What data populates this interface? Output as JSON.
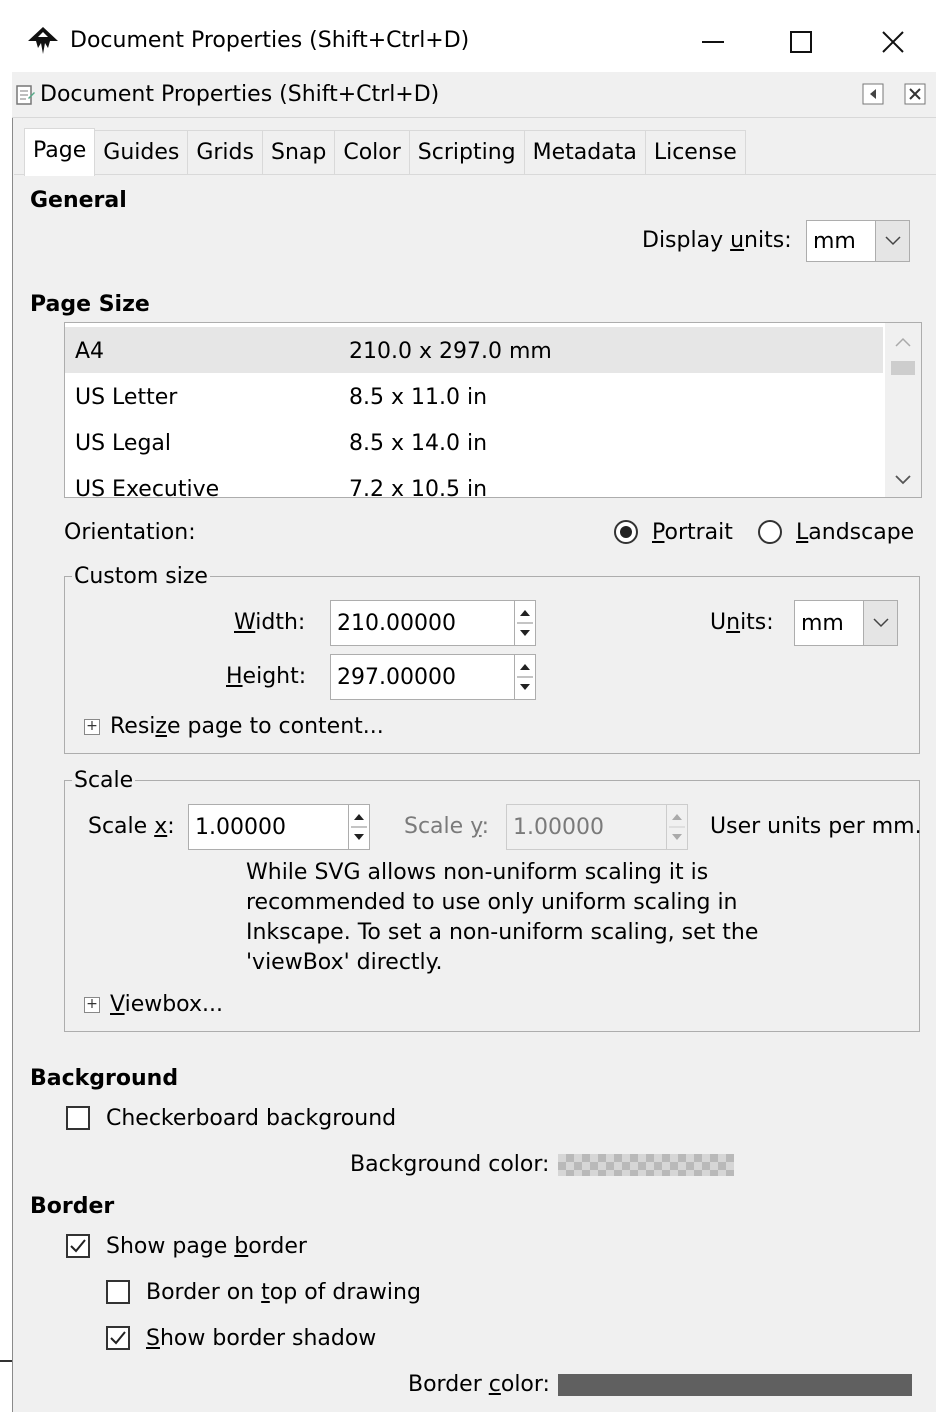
{
  "window": {
    "title": "Document Properties (Shift+Ctrl+D)",
    "minimize_glyph": "—",
    "maximize_glyph": "☐",
    "close_glyph": "✕"
  },
  "panel": {
    "title": "Document Properties (Shift+Ctrl+D)"
  },
  "tabs": [
    {
      "label": "Page",
      "active": true
    },
    {
      "label": "Guides"
    },
    {
      "label": "Grids"
    },
    {
      "label": "Snap"
    },
    {
      "label": "Color"
    },
    {
      "label": "Scripting"
    },
    {
      "label": "Metadata"
    },
    {
      "label": "License"
    }
  ],
  "general": {
    "heading": "General",
    "display_units_label_pre": "Display ",
    "display_units_label_u": "u",
    "display_units_label_post": "nits:",
    "display_units_value": "mm"
  },
  "page_size": {
    "heading": "Page Size",
    "rows": [
      {
        "name": "A4",
        "size": "210.0 x 297.0 mm",
        "selected": true
      },
      {
        "name": "US Letter",
        "size": "8.5 x 11.0 in"
      },
      {
        "name": "US Legal",
        "size": "8.5 x 14.0 in"
      },
      {
        "name": "US Executive",
        "size": "7.2 x 10.5 in"
      }
    ]
  },
  "orientation": {
    "label": "Orientation:",
    "portrait_u": "P",
    "portrait_rest": "ortrait",
    "landscape_u": "L",
    "landscape_rest": "andscape",
    "selected": "portrait"
  },
  "custom_size": {
    "legend": "Custom size",
    "width_u": "W",
    "width_rest": "idth:",
    "width_value": "210.00000",
    "height_u": "H",
    "height_rest": "eight:",
    "height_value": "297.00000",
    "units_pre": "U",
    "units_u": "n",
    "units_post": "its:",
    "units_value": "mm",
    "resize_pre": "Resi",
    "resize_u": "z",
    "resize_post": "e page to content..."
  },
  "scale": {
    "legend": "Scale",
    "scale_x_pre": "Scale ",
    "scale_x_u": "x",
    "scale_x_post": ":",
    "scale_x_value": "1.00000",
    "scale_y_pre": "Scale ",
    "scale_y_u": "y",
    "scale_y_post": ":",
    "scale_y_value": "1.00000",
    "units_text": "User units per mm.",
    "note_lines": [
      "While SVG allows non-uniform scaling it is",
      "recommended to use only uniform scaling in",
      "Inkscape. To set a non-uniform scaling, set the",
      "'viewBox' directly."
    ],
    "viewbox_u": "V",
    "viewbox_rest": "iewbox..."
  },
  "background": {
    "heading": "Background",
    "checkerboard_label": "Checkerboard background",
    "checkerboard_checked": false,
    "color_label": "Background color:"
  },
  "border": {
    "heading": "Border",
    "show_border_pre": "Show page ",
    "show_border_u": "b",
    "show_border_post": "order",
    "show_border_checked": true,
    "on_top_pre": "Border on ",
    "on_top_u": "t",
    "on_top_post": "op of drawing",
    "on_top_checked": false,
    "shadow_u": "S",
    "shadow_rest": "how border shadow",
    "shadow_checked": true,
    "color_pre": "Border ",
    "color_u": "c",
    "color_post": "olor:",
    "color_value": "#606060"
  },
  "colors": {
    "window_bg": "#f0f0f0",
    "selected_row": "#e6e6e6",
    "border_swatch": "#606060"
  }
}
